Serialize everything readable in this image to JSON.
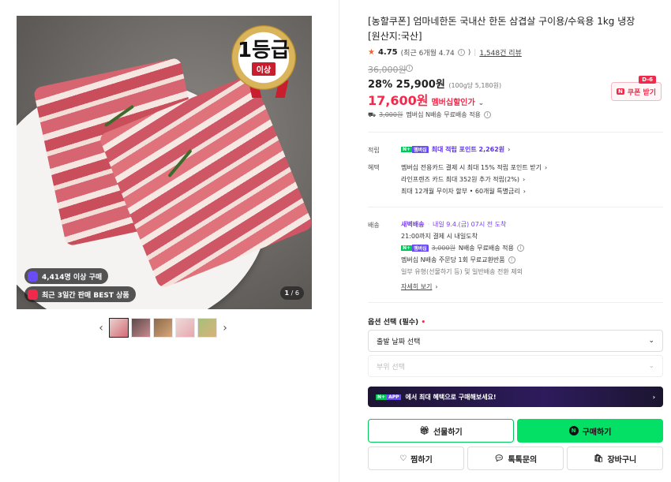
{
  "gallery": {
    "badge_top": "1등급",
    "badge_bottom": "이상",
    "chip_buyers": "4,414명 이상 구매",
    "chip_best": "최근 3일간 판매 BEST 상품",
    "pager_current": "1",
    "pager_total": "/ 6",
    "thumb_count": 5
  },
  "product": {
    "title": "[농할쿠폰] 엄마네한돈 국내산 한돈 삼겹살 구이용/수육용 1kg 냉장 [원산지:국산]",
    "rating": "4.75",
    "rating_recent": "(최근 6개월 4.74",
    "review_count": "1,548건 리뷰",
    "original_price": "36,000원",
    "discount_rate": "28%",
    "price": "25,900원",
    "unit_price": "(100g당 5,180원)",
    "member_price": "17,600원",
    "member_label": "멤버십할인가",
    "coupon_dday": "D-6",
    "coupon_label": "쿠폰 받기",
    "ship_strike": "3,000원",
    "ship_text": "멤버십 N배송 무료배송 적용"
  },
  "benefits": {
    "points_label": "적립",
    "points_text": "최대 적립 포인트 2,262원",
    "benefit_label": "혜택",
    "benefit_lines": [
      "멤버십 전용카드 결제 시 최대 15% 적립 포인트 받기",
      "라인프렌즈 카드 최대 352원 추가 적립(2%)",
      "최대 12개월 무이자 할부 • 60개월 특별금리"
    ]
  },
  "delivery": {
    "label": "배송",
    "fresh_name": "새벽배송",
    "fresh_eta": "내일 9.4.(금) 07시 전 도착",
    "cutoff": "21:00까지 결제 시 내일도착",
    "free_strike": "3,000원",
    "free_text": "N배송 무료배송 적용",
    "exchange": "멤버십 N배송 주문당 1회 무료교환반품",
    "note": "일부 유형(선물하기 등) 및 일반배송 전환 제외",
    "more": "자세히 보기"
  },
  "options": {
    "label": "옵션 선택 (필수)",
    "required_mark": "•",
    "date_select": "출발 날짜 선택",
    "part_select": "부위 선택"
  },
  "banner": {
    "app": "APP",
    "text": "에서 최대 혜택으로 구매해보세요!"
  },
  "actions": {
    "gift": "선물하기",
    "buy": "구매하기",
    "wish": "찜하기",
    "talk": "톡톡문의",
    "cart": "장바구니"
  },
  "colors": {
    "naver_green": "#03c75a",
    "sale_red": "#f2294b",
    "membership_purple": "#5a32e6"
  }
}
